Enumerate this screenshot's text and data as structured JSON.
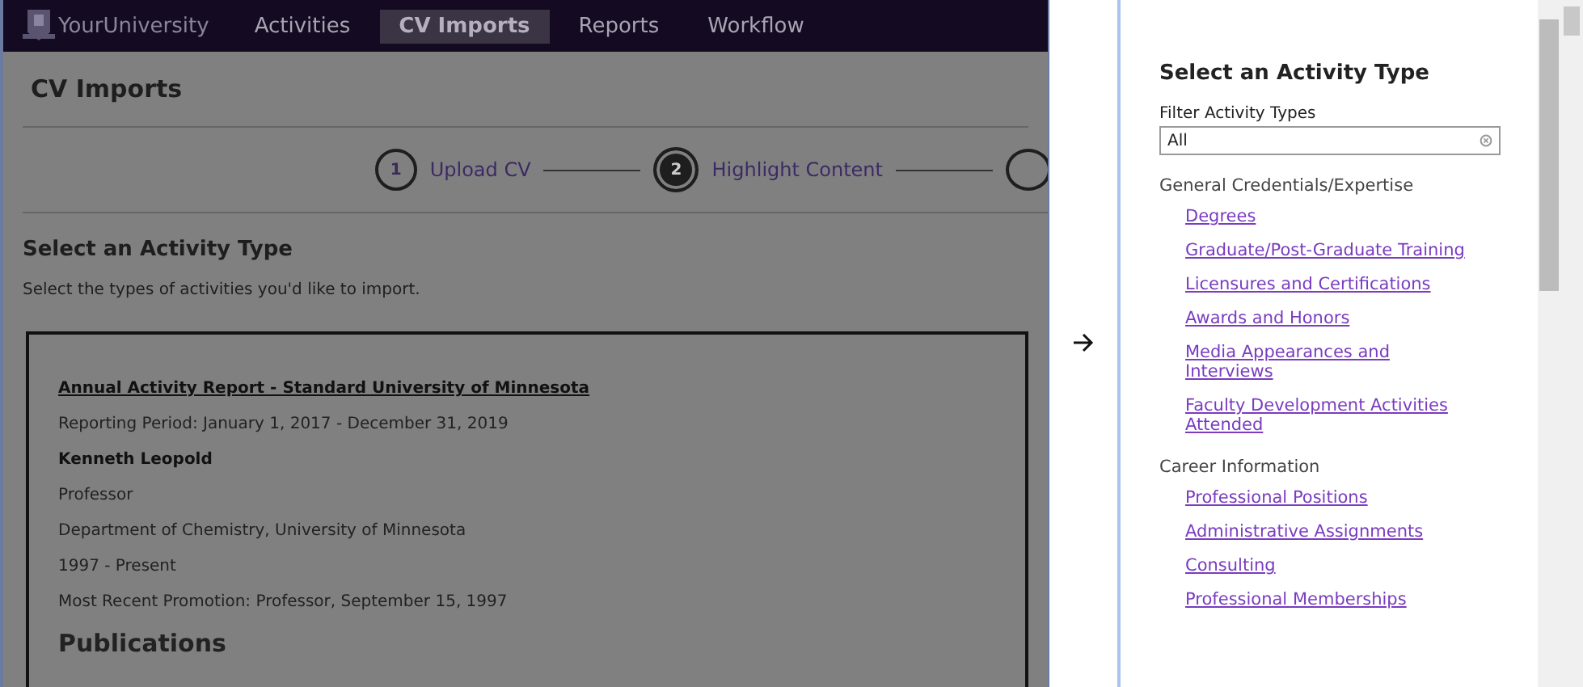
{
  "nav": {
    "logo": "YourUniversity",
    "items": [
      {
        "label": "Activities",
        "selected": false
      },
      {
        "label": "CV Imports",
        "selected": true
      },
      {
        "label": "Reports",
        "selected": false
      },
      {
        "label": "Workflow",
        "selected": false
      }
    ]
  },
  "page_title": "CV Imports",
  "steps": [
    {
      "number": "1",
      "label": "Upload CV",
      "selected": false
    },
    {
      "number": "2",
      "label": "Highlight Content",
      "selected": true
    }
  ],
  "section": {
    "title": "Select an Activity Type",
    "instructions": "Select the types of activities you'd like to import."
  },
  "document": {
    "title": "Annual Activity Report - Standard University of Minnesota",
    "lines": [
      {
        "kind": "plain",
        "text": "Reporting Period: January 1, 2017 - December 31, 2019"
      },
      {
        "kind": "bold",
        "text": "Kenneth Leopold"
      },
      {
        "kind": "plain",
        "text": "Professor"
      },
      {
        "kind": "plain",
        "text": "Department of Chemistry, University of Minnesota"
      },
      {
        "kind": "plain",
        "text": "1997 - Present"
      },
      {
        "kind": "plain",
        "text": "Most Recent Promotion: Professor, September 15, 1997"
      }
    ],
    "heading": "Publications"
  },
  "panel": {
    "title": "Select an Activity Type",
    "filter": {
      "label": "Filter Activity Types",
      "value": "All"
    },
    "groups": [
      {
        "heading": "General Credentials/Expertise",
        "items": [
          "Degrees",
          "Graduate/Post-Graduate Training",
          "Licensures and Certifications",
          "Awards and Honors",
          "Media Appearances and Interviews",
          "Faculty Development Activities Attended"
        ]
      },
      {
        "heading": "Career Information",
        "items": [
          "Professional Positions",
          "Administrative Assignments",
          "Consulting",
          "Professional Memberships"
        ]
      }
    ]
  }
}
